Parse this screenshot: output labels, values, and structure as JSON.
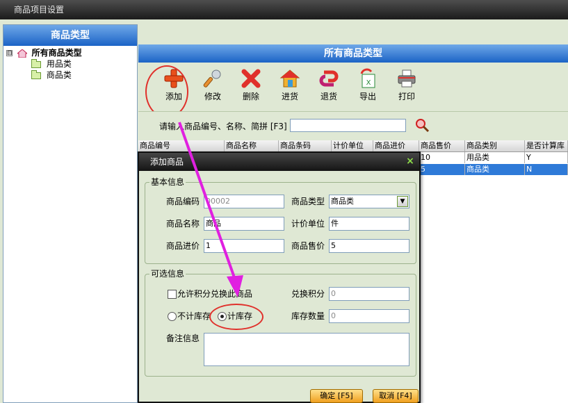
{
  "window": {
    "title": "商品项目设置"
  },
  "left_panel": {
    "header": "商品类型",
    "tree": [
      {
        "label": "所有商品类型",
        "expander": "⊟"
      },
      {
        "label": "用品类"
      },
      {
        "label": "商品类"
      }
    ]
  },
  "right_panel": {
    "header": "所有商品类型"
  },
  "toolbar": {
    "add": "添加",
    "edit": "修改",
    "delete": "删除",
    "stock_in": "进货",
    "return": "退货",
    "export": "导出",
    "print": "打印"
  },
  "search": {
    "label": "请输入商品编号、名称、简拼 [F3]",
    "value": ""
  },
  "grid": {
    "columns": [
      "商品编号",
      "商品名称",
      "商品条码",
      "计价单位",
      "商品进价",
      "商品售价",
      "商品类别",
      "是否计算库"
    ],
    "rows": [
      {
        "price": "10",
        "category": "用品类",
        "calc": "Y"
      },
      {
        "price": "5",
        "category": "商品类",
        "calc": "N"
      }
    ]
  },
  "dialog": {
    "title": "添加商品",
    "close": "×",
    "basic": {
      "title": "基本信息",
      "code_label": "商品编码",
      "code_value": "00002",
      "type_label": "商品类型",
      "type_value": "商品类",
      "name_label": "商品名称",
      "name_value": "商品",
      "unit_label": "计价单位",
      "unit_value": "件",
      "cost_label": "商品进价",
      "cost_value": "1",
      "price_label": "商品售价",
      "price_value": "5"
    },
    "optional": {
      "title": "可选信息",
      "points_check": "允许积分兑换此商品",
      "points_label": "兑换积分",
      "points_value": "0",
      "no_stock": "不计库存",
      "count_stock": "计库存",
      "stock_label": "库存数量",
      "stock_value": "0",
      "remark_label": "备注信息",
      "remark_value": ""
    },
    "ok": "确定 [F5]",
    "cancel": "取消 [F4]"
  },
  "colors": {
    "accent": "#1b63c6",
    "highlight": "#e0302b",
    "arrow": "#e020e0"
  }
}
